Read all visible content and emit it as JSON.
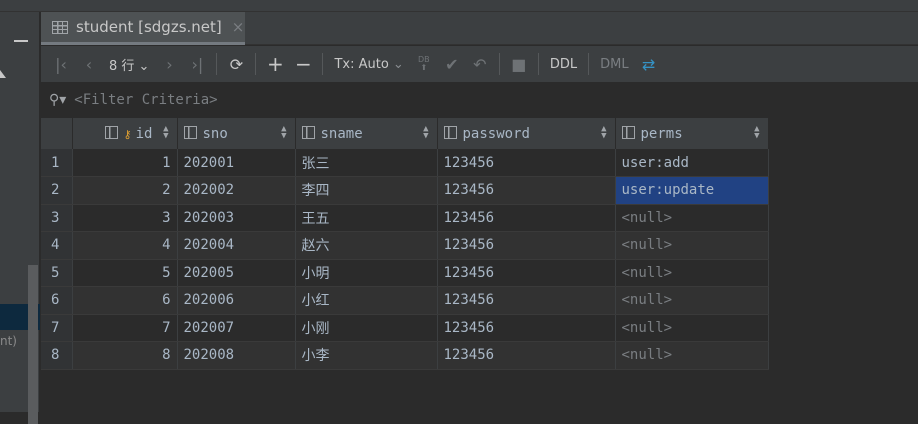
{
  "tab": {
    "title": "student [sdgzs.net]",
    "close": "×"
  },
  "toolbar": {
    "rows_label": "8 行",
    "tx_label": "Tx: Auto",
    "ddl": "DDL",
    "dml": "DML",
    "db_label": "DB"
  },
  "filter": {
    "placeholder": "<Filter Criteria>"
  },
  "left_panel": {
    "fragment": "nt)"
  },
  "table": {
    "columns": [
      "id",
      "sno",
      "sname",
      "password",
      "perms"
    ],
    "rows": [
      {
        "n": "1",
        "id": "1",
        "sno": "202001",
        "sname": "张三",
        "password": "123456",
        "perms": "user:add"
      },
      {
        "n": "2",
        "id": "2",
        "sno": "202002",
        "sname": "李四",
        "password": "123456",
        "perms": "user:update"
      },
      {
        "n": "3",
        "id": "3",
        "sno": "202003",
        "sname": "王五",
        "password": "123456",
        "perms": "<null>"
      },
      {
        "n": "4",
        "id": "4",
        "sno": "202004",
        "sname": "赵六",
        "password": "123456",
        "perms": "<null>"
      },
      {
        "n": "5",
        "id": "5",
        "sno": "202005",
        "sname": "小明",
        "password": "123456",
        "perms": "<null>"
      },
      {
        "n": "6",
        "id": "6",
        "sno": "202006",
        "sname": "小红",
        "password": "123456",
        "perms": "<null>"
      },
      {
        "n": "7",
        "id": "7",
        "sno": "202007",
        "sname": "小刚",
        "password": "123456",
        "perms": "<null>"
      },
      {
        "n": "8",
        "id": "8",
        "sno": "202008",
        "sname": "小李",
        "password": "123456",
        "perms": "<null>"
      }
    ]
  }
}
